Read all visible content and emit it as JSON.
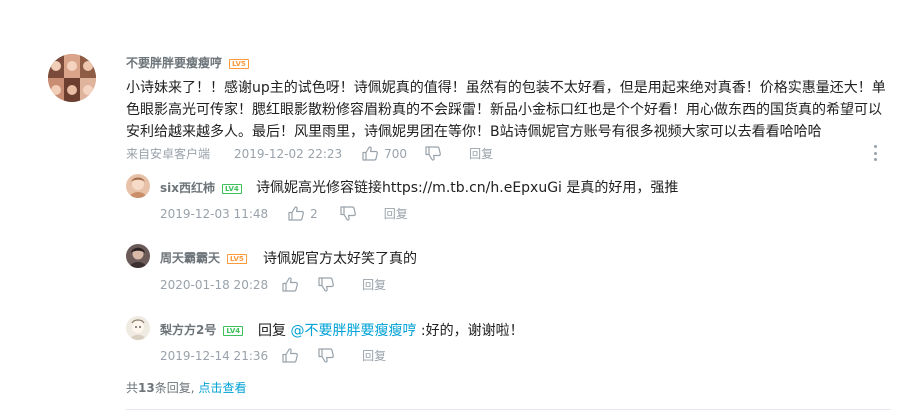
{
  "main_comment": {
    "username": "不要胖胖要瘦瘦哼",
    "level": "LV5",
    "text": "小诗妹来了！！感谢up主的试色呀！诗佩妮真的值得！虽然有的包装不太好看，但是用起来绝对真香！价格实惠量还大！单色眼影高光可传家！腮红眼影散粉修容眉粉真的不会踩雷！新品小金标口红也是个个好看！用心做东西的国货真的希望可以安利给越来越多人。最后！风里雨里，诗佩妮男团在等你！B站诗佩妮官方账号有很多视频大家可以去看看哈哈哈",
    "source": "来自安卓客户端",
    "time": "2019-12-02 22:23",
    "likes": "700",
    "reply_label": "回复"
  },
  "replies": [
    {
      "username": "six西红柿",
      "level": "LV4",
      "text": "诗佩妮高光修容链接https://m.tb.cn/h.eEpxuGi 是真的好用，强推",
      "time": "2019-12-03 11:48",
      "likes": "2",
      "reply_label": "回复"
    },
    {
      "username": "周天霸霸天",
      "level": "LV5",
      "text": "诗佩妮官方太好笑了真的",
      "time": "2020-01-18 20:28",
      "likes": "",
      "reply_label": "回复"
    },
    {
      "username": "梨方方2号",
      "level": "LV4",
      "text_prefix": "回复 ",
      "mention": "@不要胖胖要瘦瘦哼",
      "text_suffix": " :好的，谢谢啦！",
      "time": "2019-12-14 21:36",
      "likes": "",
      "reply_label": "回复"
    }
  ],
  "footer": {
    "total_prefix": "共",
    "total_count": "13",
    "total_suffix": "条回复,",
    "view_all": "点击查看"
  },
  "icons": {
    "like": "thumbs-up-icon",
    "dislike": "thumbs-down-icon",
    "more": "vertical-ellipsis-icon"
  },
  "colors": {
    "username": "#6d757a",
    "meta": "#99a2aa",
    "link": "#00a1d6",
    "level_orange": "#ff9a3c",
    "level_green": "#3ec15b",
    "divider": "#e5e9ef"
  }
}
